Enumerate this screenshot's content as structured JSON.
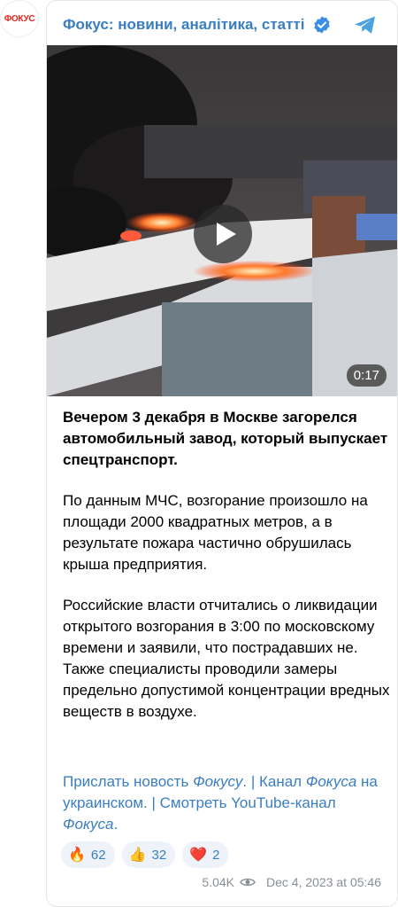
{
  "avatar": {
    "label": "ФОКУС"
  },
  "channel": {
    "title": "Фокус: новини, аналітика, статті"
  },
  "video": {
    "duration": "0:17"
  },
  "post": {
    "headline": "Вечером 3 декабря в Москве загорелся автомобильный завод, который выпускает спецтранспорт.",
    "paragraph1": "По данным МЧС, возгорание произошло на площади 2000 квадратных метров, а в результате пожара частично обрушилась крыша предприятия.",
    "paragraph2": "Российские власти отчитались о ликвидации открытого возгорания в 3:00 по московскому времени и заявили, что пострадавших не. Также специалисты проводили замеры предельно допустимой концентрации вредных веществ в воздухе."
  },
  "links": {
    "send_news": "Прислать новость",
    "fokusu": "Фокусу",
    "sep1": ". | ",
    "channel": "Канал",
    "fokusa": "Фокуса",
    "ukr": "на украинском",
    "sep2": ". | ",
    "watch": "Смотреть YouTube-канал",
    "fokusa2": "Фокуса",
    "dot": "."
  },
  "reactions": [
    {
      "emoji": "🔥",
      "count": "62"
    },
    {
      "emoji": "👍",
      "count": "32"
    },
    {
      "emoji": "❤️",
      "count": "2"
    }
  ],
  "footer": {
    "views": "5.04K",
    "date": "Dec 4, 2023 at 05:46"
  },
  "colors": {
    "link": "#3a7ec1",
    "brand": "#e1251b"
  }
}
